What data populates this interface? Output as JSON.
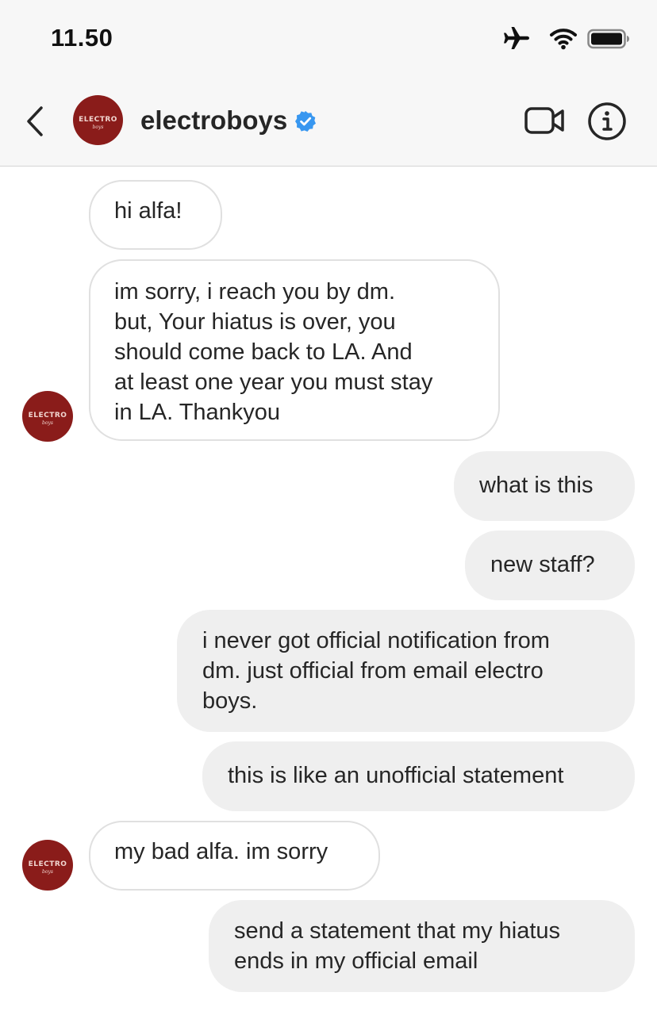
{
  "status_bar": {
    "time": "11.50"
  },
  "header": {
    "username": "electroboys",
    "avatar_logo": "ELECTRO",
    "avatar_logo_sub": "boys"
  },
  "messages": [
    {
      "sender": "electroboys",
      "direction": "incoming",
      "text": "hi alfa!"
    },
    {
      "sender": "electroboys",
      "direction": "incoming",
      "text": "im sorry, i reach you by dm.\nbut, Your hiatus is over, you\nshould come back to LA. And\nat least one year you must stay\nin LA. Thankyou"
    },
    {
      "sender": "me",
      "direction": "outgoing",
      "text": "what is this"
    },
    {
      "sender": "me",
      "direction": "outgoing",
      "text": "new staff?"
    },
    {
      "sender": "me",
      "direction": "outgoing",
      "text": "i never got official notification from\ndm. just official from email electro\nboys."
    },
    {
      "sender": "me",
      "direction": "outgoing",
      "text": "this is like an unofficial statement"
    },
    {
      "sender": "electroboys",
      "direction": "incoming",
      "text": "my bad alfa. im sorry"
    },
    {
      "sender": "me",
      "direction": "outgoing",
      "text": "send a statement that my hiatus\nends in my official email"
    }
  ],
  "colors": {
    "avatar_bg": "#8a1c1a",
    "verified_badge": "#3897f0",
    "outgoing_bubble": "#efefef",
    "incoming_border": "#e0e0e0"
  }
}
